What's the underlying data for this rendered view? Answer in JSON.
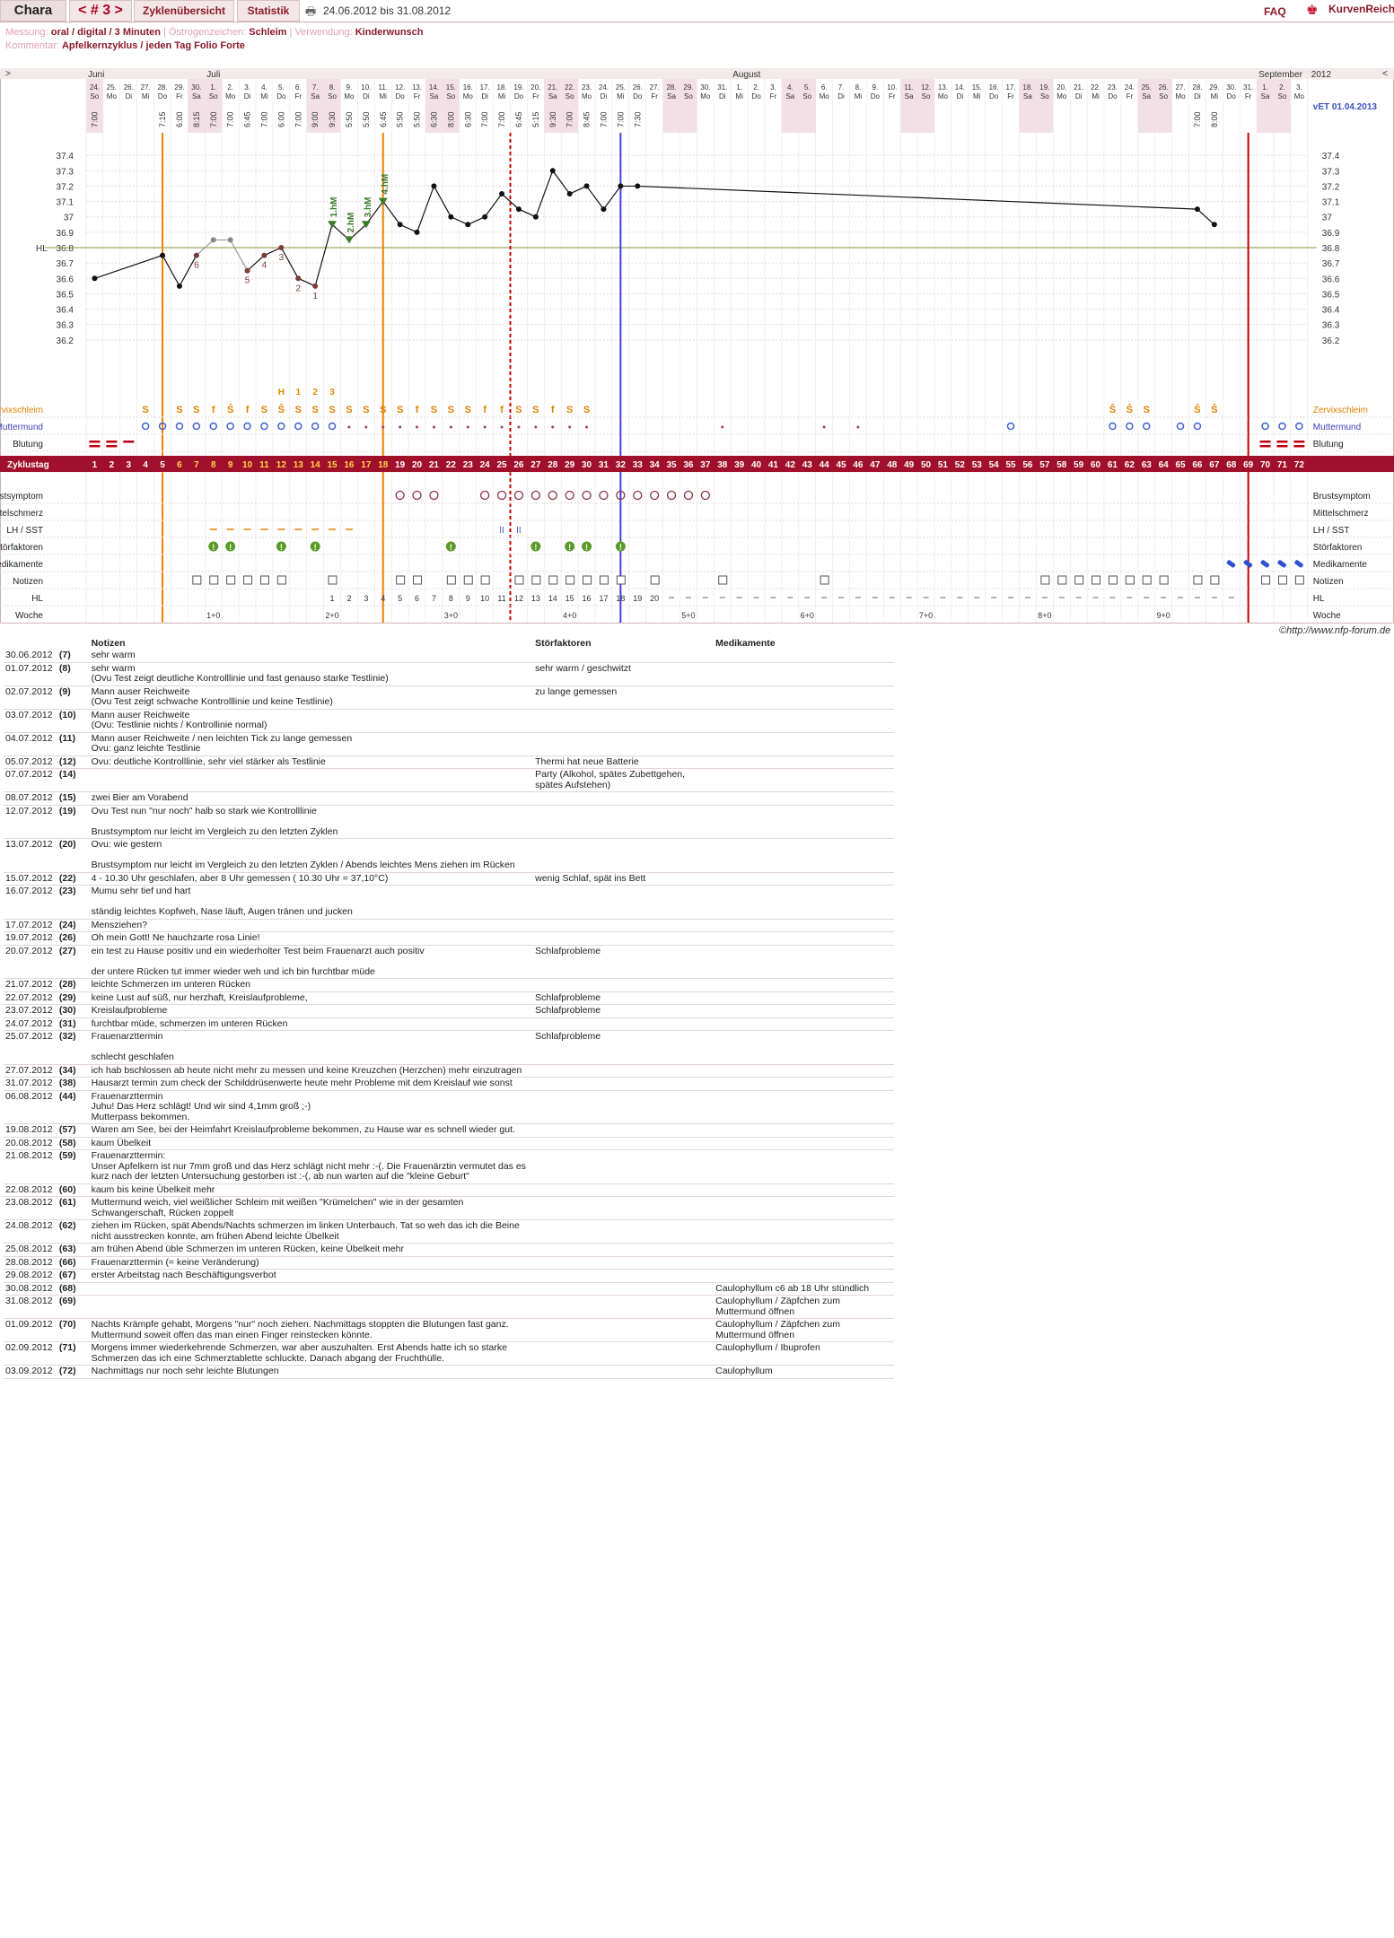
{
  "header": {
    "user": "Chara",
    "cycle": "< # 3 >",
    "tab_overview": "Zyklenübersicht",
    "tab_stats": "Statistik",
    "date_range": "24.06.2012 bis 31.08.2012",
    "faq": "FAQ",
    "brand": "KurvenReich"
  },
  "meta": {
    "messung_label": "Messung:",
    "messung_value": "oral / digital / 3 Minuten",
    "oestro_label": "Östrogenzeichen:",
    "oestro_value": "Schleim",
    "verw_label": "Verwendung:",
    "verw_value": "Kinderwunsch",
    "komm_label": "Kommentar:",
    "komm_value": "Apfelkernzyklus / jeden Tag Folio Forte"
  },
  "chart_data": {
    "type": "line",
    "year": "2012",
    "vet": "vET 01.04.2013",
    "hl_label": "HL",
    "hl_value": 36.8,
    "months": [
      {
        "label": "Juni",
        "start": 0
      },
      {
        "label": "Juli",
        "start": 7
      },
      {
        "label": "August",
        "start": 38
      },
      {
        "label": "September",
        "start": 69
      }
    ],
    "day_nums": [
      "24",
      "25",
      "26",
      "27",
      "28",
      "29",
      "30",
      "1",
      "2",
      "3",
      "4",
      "5",
      "6",
      "7",
      "8",
      "9",
      "10",
      "11",
      "12",
      "13",
      "14",
      "15",
      "16",
      "17",
      "18",
      "19",
      "20",
      "21",
      "22",
      "23",
      "24",
      "25",
      "26",
      "27",
      "28",
      "29",
      "30",
      "31",
      "1",
      "2",
      "3",
      "4",
      "5",
      "6",
      "7",
      "8",
      "9",
      "10",
      "11",
      "12",
      "13",
      "14",
      "15",
      "16",
      "17",
      "18",
      "19",
      "20",
      "21",
      "22",
      "23",
      "24",
      "25",
      "26",
      "27",
      "28",
      "29",
      "30",
      "31",
      "1",
      "2",
      "3"
    ],
    "weekdays": [
      "So",
      "Mo",
      "Di",
      "Mi",
      "Do",
      "Fr",
      "Sa",
      "So",
      "Mo",
      "Di",
      "Mi",
      "Do",
      "Fr",
      "Sa",
      "So",
      "Mo",
      "Di",
      "Mi",
      "Do",
      "Fr",
      "Sa",
      "So",
      "Mo",
      "Di",
      "Mi",
      "Do",
      "Fr",
      "Sa",
      "So",
      "Mo",
      "Di",
      "Mi",
      "Do",
      "Fr",
      "Sa",
      "So",
      "Mo",
      "Di",
      "Mi",
      "Do",
      "Fr",
      "Sa",
      "So",
      "Mo",
      "Di",
      "Mi",
      "Do",
      "Fr",
      "Sa",
      "So",
      "Mo",
      "Di",
      "Mi",
      "Do",
      "Fr",
      "Sa",
      "So",
      "Mo",
      "Di",
      "Mi",
      "Do",
      "Fr",
      "Sa",
      "So",
      "Mo",
      "Di",
      "Mi",
      "Do",
      "Fr",
      "Sa",
      "So",
      "Mo"
    ],
    "times": [
      "7:00",
      "",
      "",
      "",
      "7:15",
      "6:00",
      "8:15",
      "7:00",
      "7:00",
      "6:45",
      "7:00",
      "6:00",
      "7:00",
      "9:00",
      "9:30",
      "5:50",
      "5:50",
      "6:45",
      "5:50",
      "5:50",
      "6:30",
      "8:00",
      "6:30",
      "7:00",
      "7:00",
      "6:45",
      "5:15",
      "9:30",
      "7:00",
      "8:45",
      "7:00",
      "7:00",
      "7:30",
      "",
      "",
      "",
      "",
      "",
      "",
      "",
      "",
      "",
      "",
      "",
      "",
      "",
      "",
      "",
      "",
      "",
      "",
      "",
      "",
      "",
      "",
      "",
      "",
      "",
      "",
      "",
      "",
      "",
      "",
      "",
      "",
      "7:00",
      "8:00",
      "",
      "",
      "",
      "",
      ""
    ],
    "y_ticks": [
      36.2,
      36.3,
      36.4,
      36.5,
      36.6,
      36.7,
      36.8,
      36.9,
      37.0,
      37.1,
      37.2,
      37.3,
      37.4
    ],
    "ylim": [
      36.1,
      37.5
    ],
    "temps": [
      {
        "d": 0,
        "t": 36.6
      },
      {
        "d": 4,
        "t": 36.75
      },
      {
        "d": 5,
        "t": 36.55
      },
      {
        "d": 6,
        "t": 36.75,
        "lbl": "6"
      },
      {
        "d": 7,
        "t": 36.85,
        "ex": true
      },
      {
        "d": 8,
        "t": 36.85,
        "ex": true
      },
      {
        "d": 9,
        "t": 36.65,
        "lbl": "5"
      },
      {
        "d": 10,
        "t": 36.75,
        "lbl": "4"
      },
      {
        "d": 11,
        "t": 36.8,
        "lbl": "3"
      },
      {
        "d": 12,
        "t": 36.6,
        "lbl": "2"
      },
      {
        "d": 13,
        "t": 36.55,
        "lbl": "1"
      },
      {
        "d": 14,
        "t": 36.95,
        "hm": "1.hM"
      },
      {
        "d": 15,
        "t": 36.85,
        "hm": "2.hM"
      },
      {
        "d": 16,
        "t": 36.95,
        "hm": "3.hM"
      },
      {
        "d": 17,
        "t": 37.1,
        "hm": "4.hM"
      },
      {
        "d": 18,
        "t": 36.95
      },
      {
        "d": 19,
        "t": 36.9
      },
      {
        "d": 20,
        "t": 37.2
      },
      {
        "d": 21,
        "t": 37.0
      },
      {
        "d": 22,
        "t": 36.95
      },
      {
        "d": 23,
        "t": 37.0
      },
      {
        "d": 24,
        "t": 37.15
      },
      {
        "d": 25,
        "t": 37.05
      },
      {
        "d": 26,
        "t": 37.0
      },
      {
        "d": 27,
        "t": 37.3
      },
      {
        "d": 28,
        "t": 37.15
      },
      {
        "d": 29,
        "t": 37.2
      },
      {
        "d": 30,
        "t": 37.05
      },
      {
        "d": 31,
        "t": 37.2
      },
      {
        "d": 32,
        "t": 37.2
      },
      {
        "d": 65,
        "t": 37.05
      },
      {
        "d": 66,
        "t": 36.95
      }
    ],
    "vlines": [
      {
        "d": 4.5,
        "color": "#f08000"
      },
      {
        "d": 17.5,
        "color": "#f08000"
      },
      {
        "d": 25.0,
        "color": "#c00000",
        "dash": true
      },
      {
        "d": 31.5,
        "color": "#4040e0"
      },
      {
        "d": 68.5,
        "color": "#c00000"
      }
    ],
    "hdays": {
      "H": 11,
      "1": 12,
      "2": 13,
      "3": 14
    },
    "rows": {
      "zervix": "Zervixschleim",
      "mutter": "Muttermund",
      "blutung": "Blutung",
      "zyklustag": "Zyklustag",
      "brust": "Brustsymptom",
      "mittel": "Mittelschmerz",
      "lh": "LH / SST",
      "stoer": "Störfaktoren",
      "medi": "Medikamente",
      "notizen": "Notizen",
      "hl": "HL",
      "woche": "Woche"
    },
    "zervix_vals": [
      "",
      "",
      "",
      "S",
      "",
      "S",
      "S",
      "f",
      "Ŝ",
      "f",
      "S",
      "Ŝ",
      "S",
      "S",
      "S",
      "S",
      "S",
      "S",
      "S",
      "f",
      "S",
      "S",
      "S",
      "f",
      "f",
      "S",
      "S",
      "f",
      "S",
      "S",
      "",
      "",
      "",
      "",
      "",
      "",
      "",
      "",
      "",
      "",
      "",
      "",
      "",
      "",
      "",
      "",
      "",
      "",
      "",
      "",
      "",
      "",
      "",
      "",
      "",
      "",
      "",
      "",
      "",
      "",
      "Ŝ",
      "Ŝ",
      "S",
      "",
      "",
      "Ŝ",
      "Ŝ",
      "",
      "",
      "",
      "",
      ""
    ],
    "hl_nums": [
      "",
      "",
      "",
      "",
      "",
      "",
      "",
      "",
      "",
      "",
      "",
      "",
      "",
      "",
      "1",
      "2",
      "3",
      "4",
      "5",
      "6",
      "7",
      "8",
      "9",
      "10",
      "11",
      "12",
      "13",
      "14",
      "15",
      "16",
      "17",
      "18",
      "19",
      "20"
    ],
    "weeks": [
      {
        "d": 7,
        "label": "1+0"
      },
      {
        "d": 14,
        "label": "2+0"
      },
      {
        "d": 21,
        "label": "3+0"
      },
      {
        "d": 28,
        "label": "4+0"
      },
      {
        "d": 35,
        "label": "5+0"
      },
      {
        "d": 42,
        "label": "6+0"
      },
      {
        "d": 49,
        "label": "7+0"
      },
      {
        "d": 56,
        "label": "8+0"
      },
      {
        "d": 63,
        "label": "9+0"
      }
    ],
    "brust_days": [
      18,
      19,
      20,
      23,
      24,
      25,
      26,
      27,
      28,
      29,
      30,
      31,
      32,
      33,
      34,
      35,
      36
    ],
    "stoer_days": [
      7,
      8,
      11,
      13,
      21,
      26,
      28,
      29,
      31
    ],
    "medi_days": [
      67,
      68,
      69,
      70,
      71
    ],
    "notiz_days": [
      6,
      7,
      8,
      9,
      10,
      11,
      14,
      18,
      19,
      21,
      22,
      23,
      25,
      26,
      27,
      28,
      29,
      30,
      31,
      33,
      37,
      43,
      56,
      57,
      58,
      59,
      60,
      61,
      62,
      63,
      65,
      66,
      69,
      70,
      71
    ],
    "blutung_days": [
      0,
      1,
      2,
      69,
      70,
      71
    ],
    "mutter_days": [
      3,
      4,
      5,
      6,
      7,
      8,
      9,
      10,
      11,
      12,
      13,
      14,
      15,
      16,
      17,
      18,
      19,
      20,
      21,
      22,
      23,
      24,
      25,
      26,
      27,
      28,
      29,
      37,
      43,
      45,
      54,
      60,
      61,
      62,
      64,
      65,
      69,
      70,
      71
    ]
  },
  "copyright": "©http://www.nfp-forum.de",
  "notes_table": {
    "col_notes": "Notizen",
    "col_stoer": "Störfaktoren",
    "col_med": "Medikamente",
    "rows": [
      [
        "30.06.2012",
        "(7)",
        "sehr warm",
        "",
        ""
      ],
      [
        "01.07.2012",
        "(8)",
        "sehr warm\n(Ovu Test zeigt deutliche Kontrolllinie und fast genauso starke Testlinie)",
        "sehr warm / geschwitzt",
        ""
      ],
      [
        "02.07.2012",
        "(9)",
        "Mann auser Reichweite\n(Ovu Test zeigt schwache Kontrolllinie und keine Testlinie)",
        "zu lange gemessen",
        ""
      ],
      [
        "03.07.2012",
        "(10)",
        "Mann auser Reichweite\n(Ovu: Testlinie nichts / Kontrollinie normal)",
        "",
        ""
      ],
      [
        "04.07.2012",
        "(11)",
        "Mann auser Reichweite / nen leichten Tick zu lange gemessen\nOvu: ganz leichte Testlinie",
        "",
        ""
      ],
      [
        "05.07.2012",
        "(12)",
        "Ovu: deutliche Kontrolllinie, sehr viel stärker als Testlinie",
        "Thermi hat neue Batterie",
        ""
      ],
      [
        "07.07.2012",
        "(14)",
        "",
        "Party (Alkohol, spätes Zubettgehen, spätes Aufstehen)",
        ""
      ],
      [
        "08.07.2012",
        "(15)",
        "zwei Bier am Vorabend",
        "",
        ""
      ],
      [
        "12.07.2012",
        "(19)",
        "Ovu Test nun \"nur noch\" halb so stark wie Kontrolllinie\n\nBrustsymptom nur leicht im Vergleich zu den letzten Zyklen",
        "",
        ""
      ],
      [
        "13.07.2012",
        "(20)",
        "Ovu: wie gestern\n\nBrustsymptom nur leicht im Vergleich zu den letzten Zyklen / Abends leichtes Mens ziehen im Rücken",
        "",
        ""
      ],
      [
        "15.07.2012",
        "(22)",
        "4 - 10.30 Uhr geschlafen, aber 8 Uhr gemessen ( 10.30 Uhr = 37,10°C)",
        "wenig Schlaf, spät ins Bett",
        ""
      ],
      [
        "16.07.2012",
        "(23)",
        "Mumu sehr tief und hart\n\nständig leichtes Kopfweh, Nase läuft, Augen tränen und jucken",
        "",
        ""
      ],
      [
        "17.07.2012",
        "(24)",
        "Mensziehen?",
        "",
        ""
      ],
      [
        "19.07.2012",
        "(26)",
        "Oh mein Gott! Ne hauchzarte rosa Linie!",
        "",
        ""
      ],
      [
        "20.07.2012",
        "(27)",
        "ein test zu Hause positiv und ein wiederholter Test beim Frauenarzt auch positiv\n\nder untere Rücken tut immer wieder weh und ich bin furchtbar müde",
        "Schlafprobleme",
        ""
      ],
      [
        "21.07.2012",
        "(28)",
        "leichte Schmerzen im unteren Rücken",
        "",
        ""
      ],
      [
        "22.07.2012",
        "(29)",
        "keine Lust auf süß, nur herzhaft, Kreislaufprobleme,",
        "Schlafprobleme",
        ""
      ],
      [
        "23.07.2012",
        "(30)",
        "Kreislaufprobleme",
        "Schlafprobleme",
        ""
      ],
      [
        "24.07.2012",
        "(31)",
        "furchtbar müde, schmerzen im unteren Rücken",
        "",
        ""
      ],
      [
        "25.07.2012",
        "(32)",
        "Frauenarzttermin\n\nschlecht geschlafen",
        "Schlafprobleme",
        ""
      ],
      [
        "27.07.2012",
        "(34)",
        "ich hab bschlossen ab heute nicht mehr zu messen und keine Kreuzchen (Herzchen) mehr einzutragen",
        "",
        ""
      ],
      [
        "31.07.2012",
        "(38)",
        "Hausarzt termin zum check der Schilddrüsenwerte heute mehr Probleme mit dem Kreislauf wie sonst",
        "",
        ""
      ],
      [
        "06.08.2012",
        "(44)",
        "Frauenarzttermin\nJuhu! Das Herz schlägt! Und wir sind 4,1mm groß ;-)\nMutterpass bekommen.",
        "",
        ""
      ],
      [
        "19.08.2012",
        "(57)",
        "Waren am See, bei der Heimfahrt Kreislaufprobleme bekommen, zu Hause war es schnell wieder gut.",
        "",
        ""
      ],
      [
        "20.08.2012",
        "(58)",
        "kaum Übelkeit",
        "",
        ""
      ],
      [
        "21.08.2012",
        "(59)",
        "Frauenarzttermin:\nUnser Apfelkern ist nur 7mm groß und das Herz schlägt nicht mehr :-(. Die Frauenärztin vermutet das es kurz nach der letzten Untersuchung gestorben ist :-(, ab nun warten auf die \"kleine Geburt\"",
        "",
        ""
      ],
      [
        "22.08.2012",
        "(60)",
        "kaum bis keine Übelkeit mehr",
        "",
        ""
      ],
      [
        "23.08.2012",
        "(61)",
        "Muttermund weich, viel weißlicher Schleim mit weißen \"Krümelchen\" wie in der gesamten Schwangerschaft, Rücken zoppelt",
        "",
        ""
      ],
      [
        "24.08.2012",
        "(62)",
        "ziehen im Rücken, spät Abends/Nachts schmerzen im linken Unterbauch. Tat so weh das ich die Beine nicht ausstrecken konnte, am frühen Abend leichte Übelkeit",
        "",
        ""
      ],
      [
        "25.08.2012",
        "(63)",
        "am frühen Abend üble Schmerzen im unteren Rücken, keine Übelkeit mehr",
        "",
        ""
      ],
      [
        "28.08.2012",
        "(66)",
        "Frauenarzttermin (= keine Veränderung)",
        "",
        ""
      ],
      [
        "29.08.2012",
        "(67)",
        "erster Arbeitstag nach Beschäftigungsverbot",
        "",
        ""
      ],
      [
        "30.08.2012",
        "(68)",
        "",
        "",
        "Caulophyllum c6 ab 18 Uhr stündlich"
      ],
      [
        "31.08.2012",
        "(69)",
        "",
        "",
        "Caulophyllum / Zäpfchen zum Muttermund öffnen"
      ],
      [
        "01.09.2012",
        "(70)",
        "Nachts Krämpfe gehabt, Morgens \"nur\" noch ziehen. Nachmittags stoppten die Blutungen fast ganz. Muttermund soweit offen das man einen Finger reinstecken könnte.",
        "",
        "Caulophyllum / Zäpfchen zum Muttermund öffnen"
      ],
      [
        "02.09.2012",
        "(71)",
        "Morgens immer wiederkehrende Schmerzen, war aber auszuhalten. Erst Abends hatte ich so starke Schmerzen das ich eine Schmerztablette schluckte. Danach abgang der Fruchthülle.",
        "",
        "Caulophyllum / Ibuprofen"
      ],
      [
        "03.09.2012",
        "(72)",
        "Nachmittags nur noch sehr leichte Blutungen",
        "",
        "Caulophyllum"
      ]
    ]
  }
}
